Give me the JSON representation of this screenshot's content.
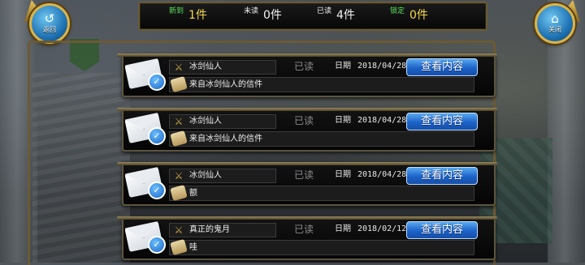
{
  "buttons": {
    "back_glyph": "↺",
    "back_label": "返回",
    "close_glyph": "⌂",
    "close_label": "关闭"
  },
  "status": {
    "new_label": "新到",
    "new_value": "1件",
    "unread_label": "未读",
    "unread_value": "0件",
    "read_label": "已读",
    "read_value": "4件",
    "locked_label": "锁定",
    "locked_value": "0件"
  },
  "colors": {
    "accent_gold": "#f5d84a",
    "locked_green": "#5de05d",
    "button_blue": "#1c62c8"
  },
  "mails": [
    {
      "sender": "冰剑仙人",
      "subject": "来自冰剑仙人的信件",
      "status": "已读",
      "date_label": "日期",
      "date": "2018/04/28",
      "action": "查看内容"
    },
    {
      "sender": "冰剑仙人",
      "subject": "来自冰剑仙人的信件",
      "status": "已读",
      "date_label": "日期",
      "date": "2018/04/28",
      "action": "查看内容"
    },
    {
      "sender": "冰剑仙人",
      "subject": "额",
      "status": "已读",
      "date_label": "日期",
      "date": "2018/04/28",
      "action": "查看内容"
    },
    {
      "sender": "真正的鬼月",
      "subject": "哇",
      "status": "已读",
      "date_label": "日期",
      "date": "2018/02/12",
      "action": "查看内容"
    }
  ]
}
